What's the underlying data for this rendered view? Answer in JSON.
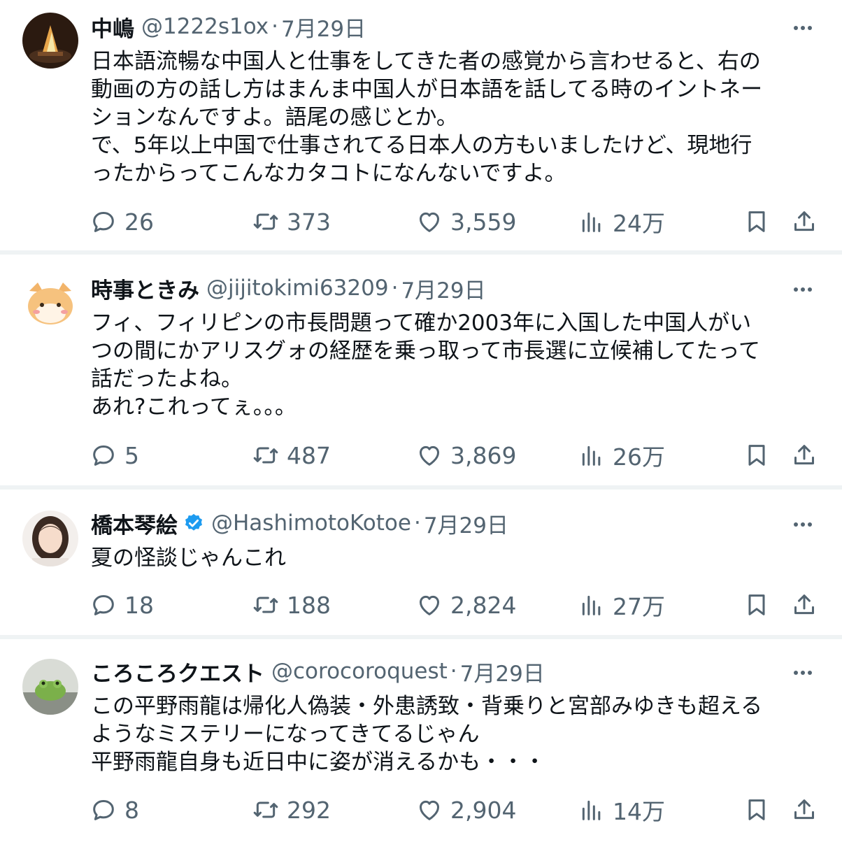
{
  "tweets": [
    {
      "name": "中嶋",
      "handle": "@1222s1ox",
      "sep": "·",
      "date": "7月29日",
      "verified": false,
      "text_lines": [
        "日本語流暢な中国人と仕事をしてきた者の感覚から言わせると、右の",
        "動画の方の話し方はまんま中国人が日本語を話してる時のイントネー",
        "ションなんですよ。語尾の感じとか。",
        "で、5年以上中国で仕事されてる日本人の方もいましたけど、現地行",
        "ったからってこんなカタコトになんないですよ。"
      ],
      "replies": "26",
      "retweets": "373",
      "likes": "3,559",
      "views": "24万",
      "avatar_icon": "avatar-campfire"
    },
    {
      "name": "時事ときみ",
      "handle": "@jijitokimi63209",
      "sep": "·",
      "date": "7月29日",
      "verified": false,
      "text_lines": [
        "フィ、フィリピンの市長問題って確か2003年に入国した中国人がい",
        "つの間にかアリスグォの経歴を乗っ取って市長選に立候補してたって",
        "話だったよね。",
        "あれ?これってぇ。。。"
      ],
      "replies": "5",
      "retweets": "487",
      "likes": "3,869",
      "views": "26万",
      "avatar_icon": "avatar-hamster"
    },
    {
      "name": "橋本琴絵",
      "handle": "@HashimotoKotoe",
      "sep": "·",
      "date": "7月29日",
      "verified": true,
      "text_lines": [
        "夏の怪談じゃんこれ"
      ],
      "replies": "18",
      "retweets": "188",
      "likes": "2,824",
      "views": "27万",
      "avatar_icon": "avatar-woman"
    },
    {
      "name": "ころころクエスト",
      "handle": "@corocoroquest",
      "sep": "·",
      "date": "7月29日",
      "verified": false,
      "text_lines": [
        "この平野雨龍は帰化人偽装・外患誘致・背乗りと宮部みゆきも超える",
        "ようなミステリーになってきてるじゃん",
        "平野雨龍自身も近日中に姿が消えるかも・・・"
      ],
      "replies": "8",
      "retweets": "292",
      "likes": "2,904",
      "views": "14万",
      "avatar_icon": "avatar-frog"
    }
  ],
  "icons": {
    "reply": "reply-icon",
    "retweet": "retweet-icon",
    "like": "like-icon",
    "views": "views-icon",
    "bookmark": "bookmark-icon",
    "share": "share-icon",
    "more": "more-icon",
    "verified": "verified-badge-icon"
  },
  "colors": {
    "text": "#0f1419",
    "secondary": "#536471",
    "verified": "#1d9bf0",
    "divider": "#eff3f4"
  }
}
